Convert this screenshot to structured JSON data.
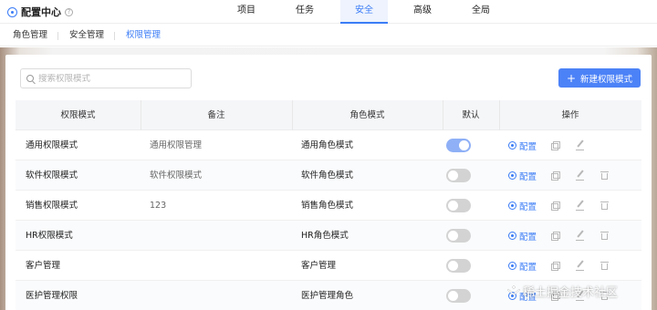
{
  "header": {
    "title": "配置中心",
    "help": "?",
    "nav": [
      "项目",
      "任务",
      "安全",
      "高级",
      "全局"
    ],
    "active_nav": "安全"
  },
  "subtabs": [
    "角色管理",
    "安全管理",
    "权限管理"
  ],
  "active_subtab": "权限管理",
  "toolbar": {
    "search_placeholder": "搜索权限模式",
    "new_label": "新建权限模式",
    "plus": "+"
  },
  "table": {
    "headers": [
      "权限模式",
      "备注",
      "角色模式",
      "默认",
      "操作"
    ],
    "rows": [
      {
        "mode": "通用权限模式",
        "note": "通用权限管理",
        "role": "通用角色模式",
        "default": true,
        "has_delete": false
      },
      {
        "mode": "软件权限模式",
        "note": "软件权限模式",
        "role": "软件角色模式",
        "default": false,
        "has_delete": true
      },
      {
        "mode": "销售权限模式",
        "note": "123",
        "role": "销售角色模式",
        "default": false,
        "has_delete": true
      },
      {
        "mode": "HR权限模式",
        "note": "",
        "role": "HR角色模式",
        "default": false,
        "has_delete": true
      },
      {
        "mode": "客户管理",
        "note": "",
        "role": "客户管理",
        "default": false,
        "has_delete": true
      },
      {
        "mode": "医护管理权限",
        "note": "",
        "role": "医护管理角色",
        "default": false,
        "has_delete": true
      }
    ],
    "config_label": "配置"
  },
  "watermark": "稀土掘金技术社区",
  "colors": {
    "accent": "#3b7cf6",
    "button": "#4c82f7",
    "toggle_on": "#8fb0f6",
    "toggle_off": "#d3d3d3"
  }
}
